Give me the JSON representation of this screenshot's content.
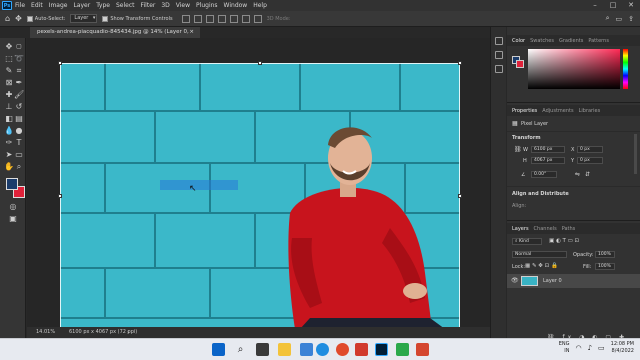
{
  "menu": {
    "items": [
      "File",
      "Edit",
      "Image",
      "Layer",
      "Type",
      "Select",
      "Filter",
      "3D",
      "View",
      "Plugins",
      "Window",
      "Help"
    ],
    "logo": "Ps"
  },
  "options": {
    "auto_select_label": "Auto-Select:",
    "auto_select_value": "Layer",
    "show_transform_label": "Show Transform Controls",
    "mode_3d": "3D Mode:"
  },
  "document": {
    "tab_title": "pexels-andrea-piacquadio-845434.jpg @ 14% (Layer 0, RGB/8) *",
    "zoom": "14.01%",
    "size_info": "6100 px x 4067 px (72 ppi)"
  },
  "color_panel": {
    "tabs": [
      "Color",
      "Swatches",
      "Gradients",
      "Patterns"
    ],
    "accent": "#ff2a55"
  },
  "properties_panel": {
    "tabs": [
      "Properties",
      "Adjustments",
      "Libraries"
    ],
    "kind": "Pixel Layer",
    "section_transform": "Transform",
    "w_label": "W",
    "w_value": "6100 px",
    "h_label": "H",
    "h_value": "4067 px",
    "x_label": "X",
    "x_value": "0 px",
    "y_label": "Y",
    "y_value": "0 px",
    "angle_value": "0.00°",
    "section_align": "Align and Distribute",
    "align_label": "Align:"
  },
  "layers_panel": {
    "tabs": [
      "Layers",
      "Channels",
      "Paths"
    ],
    "kind_label": "Kind",
    "blend_mode": "Normal",
    "opacity_label": "Opacity:",
    "opacity_value": "100%",
    "lock_label": "Lock:",
    "fill_label": "Fill:",
    "fill_value": "100%",
    "layer_name": "Layer 0"
  },
  "taskbar": {
    "lang": "ENG",
    "region": "IN",
    "time": "12:08 PM",
    "date": "8/4/2022"
  },
  "icons": [
    "move-icon",
    "marquee-icon",
    "lasso-icon",
    "crop-icon",
    "eyedropper-icon",
    "brush-icon",
    "eraser-icon",
    "gradient-icon",
    "pen-icon",
    "type-icon",
    "hand-icon",
    "zoom-icon"
  ]
}
